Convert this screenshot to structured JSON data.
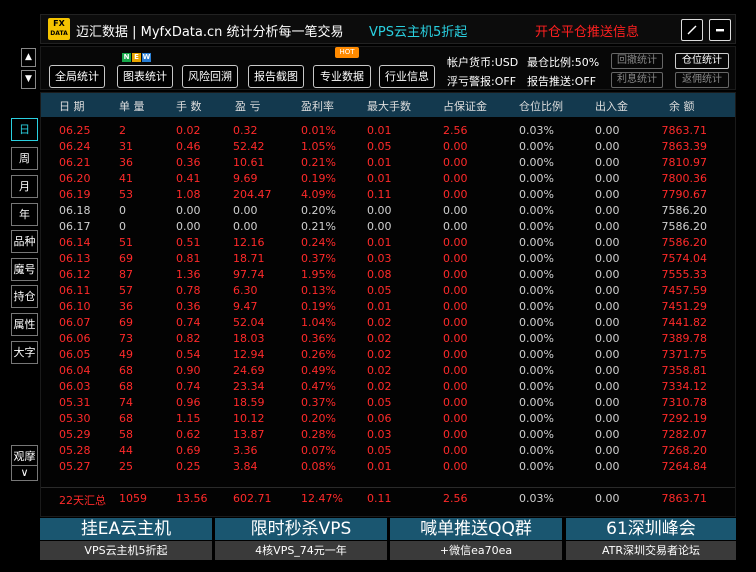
{
  "header": {
    "logo_top": "FX",
    "logo_bottom": "DATA",
    "title": "迈汇数据 | MyfxData.cn  统计分析每一笔交易",
    "promo": "VPS云主机5折起",
    "push": "开仓平仓推送信息",
    "edit_icon": "pencil-icon",
    "minimize_icon": "minus-icon"
  },
  "toolbar": {
    "buttons": [
      "全局统计",
      "图表统计",
      "风险回溯",
      "报告截图",
      "专业数据",
      "行业信息"
    ],
    "new_badge": [
      "N",
      "E",
      "W"
    ],
    "hot_badge": "HOT",
    "account_currency": "帐户货币:USD",
    "max_ratio": "最仓比例:50%",
    "float_alert": "浮亏警报:OFF",
    "report_push": "报告推送:OFF",
    "toggle": [
      "回撤统计",
      "仓位统计",
      "利息统计",
      "返佣统计"
    ]
  },
  "scroll": {
    "up": "▲",
    "down": "▼"
  },
  "sidebar": {
    "items": [
      "日",
      "周",
      "月",
      "年",
      "品种",
      "魔号",
      "持仓",
      "属性",
      "大字",
      "观摩"
    ],
    "more": "∨"
  },
  "table": {
    "headers": [
      "日 期",
      "单 量",
      "手 数",
      "盈 亏",
      "盈利率",
      "最大手数",
      "占保证金",
      "仓位比例",
      "出入金",
      "余 额"
    ],
    "rows": [
      [
        "06.25",
        "2",
        "0.02",
        "0.32",
        "0.01%",
        "0.01",
        "2.56",
        "0.03%",
        "0.00",
        "7863.71"
      ],
      [
        "06.24",
        "31",
        "0.46",
        "52.42",
        "1.05%",
        "0.05",
        "0.00",
        "0.00%",
        "0.00",
        "7863.39"
      ],
      [
        "06.21",
        "36",
        "0.36",
        "10.61",
        "0.21%",
        "0.01",
        "0.00",
        "0.00%",
        "0.00",
        "7810.97"
      ],
      [
        "06.20",
        "41",
        "0.41",
        "9.69",
        "0.19%",
        "0.01",
        "0.00",
        "0.00%",
        "0.00",
        "7800.36"
      ],
      [
        "06.19",
        "53",
        "1.08",
        "204.47",
        "4.09%",
        "0.11",
        "0.00",
        "0.00%",
        "0.00",
        "7790.67"
      ],
      [
        "06.18",
        "0",
        "0.00",
        "0.00",
        "0.20%",
        "0.00",
        "0.00",
        "0.00%",
        "0.00",
        "7586.20"
      ],
      [
        "06.17",
        "0",
        "0.00",
        "0.00",
        "0.21%",
        "0.00",
        "0.00",
        "0.00%",
        "0.00",
        "7586.20"
      ],
      [
        "06.14",
        "51",
        "0.51",
        "12.16",
        "0.24%",
        "0.01",
        "0.00",
        "0.00%",
        "0.00",
        "7586.20"
      ],
      [
        "06.13",
        "69",
        "0.81",
        "18.71",
        "0.37%",
        "0.03",
        "0.00",
        "0.00%",
        "0.00",
        "7574.04"
      ],
      [
        "06.12",
        "87",
        "1.36",
        "97.74",
        "1.95%",
        "0.08",
        "0.00",
        "0.00%",
        "0.00",
        "7555.33"
      ],
      [
        "06.11",
        "57",
        "0.78",
        "6.30",
        "0.13%",
        "0.05",
        "0.00",
        "0.00%",
        "0.00",
        "7457.59"
      ],
      [
        "06.10",
        "36",
        "0.36",
        "9.47",
        "0.19%",
        "0.01",
        "0.00",
        "0.00%",
        "0.00",
        "7451.29"
      ],
      [
        "06.07",
        "69",
        "0.74",
        "52.04",
        "1.04%",
        "0.02",
        "0.00",
        "0.00%",
        "0.00",
        "7441.82"
      ],
      [
        "06.06",
        "73",
        "0.82",
        "18.03",
        "0.36%",
        "0.02",
        "0.00",
        "0.00%",
        "0.00",
        "7389.78"
      ],
      [
        "06.05",
        "49",
        "0.54",
        "12.94",
        "0.26%",
        "0.02",
        "0.00",
        "0.00%",
        "0.00",
        "7371.75"
      ],
      [
        "06.04",
        "68",
        "0.90",
        "24.69",
        "0.49%",
        "0.02",
        "0.00",
        "0.00%",
        "0.00",
        "7358.81"
      ],
      [
        "06.03",
        "68",
        "0.74",
        "23.34",
        "0.47%",
        "0.02",
        "0.00",
        "0.00%",
        "0.00",
        "7334.12"
      ],
      [
        "05.31",
        "74",
        "0.96",
        "18.59",
        "0.37%",
        "0.05",
        "0.00",
        "0.00%",
        "0.00",
        "7310.78"
      ],
      [
        "05.30",
        "68",
        "1.15",
        "10.12",
        "0.20%",
        "0.06",
        "0.00",
        "0.00%",
        "0.00",
        "7292.19"
      ],
      [
        "05.29",
        "58",
        "0.62",
        "13.87",
        "0.28%",
        "0.03",
        "0.00",
        "0.00%",
        "0.00",
        "7282.07"
      ],
      [
        "05.28",
        "44",
        "0.69",
        "3.36",
        "0.07%",
        "0.05",
        "0.00",
        "0.00%",
        "0.00",
        "7268.20"
      ],
      [
        "05.27",
        "25",
        "0.25",
        "3.84",
        "0.08%",
        "0.01",
        "0.00",
        "0.00%",
        "0.00",
        "7264.84"
      ]
    ],
    "row_tones": [
      "red",
      "red",
      "red",
      "red",
      "red",
      "grey",
      "grey",
      "red",
      "red",
      "red",
      "red",
      "red",
      "red",
      "red",
      "red",
      "red",
      "red",
      "red",
      "red",
      "red",
      "red",
      "red"
    ],
    "summary": [
      "22天汇总",
      "1059",
      "13.56",
      "602.71",
      "12.47%",
      "0.11",
      "2.56",
      "0.03%",
      "0.00",
      "7863.71"
    ]
  },
  "ads": [
    {
      "top": "挂EA云主机",
      "bottom": "VPS云主机5折起"
    },
    {
      "top": "限时秒杀VPS",
      "bottom": "4核VPS_74元一年"
    },
    {
      "top": "喊单推送QQ群",
      "bottom": "+微信ea70ea"
    },
    {
      "top": "61深圳峰会",
      "bottom": "ATR深圳交易者论坛"
    }
  ],
  "colors": {
    "red": "#ff2a2a",
    "cyan": "#2ad0e0",
    "header_bg": "#13394e",
    "ad_bg": "#1a5670"
  }
}
